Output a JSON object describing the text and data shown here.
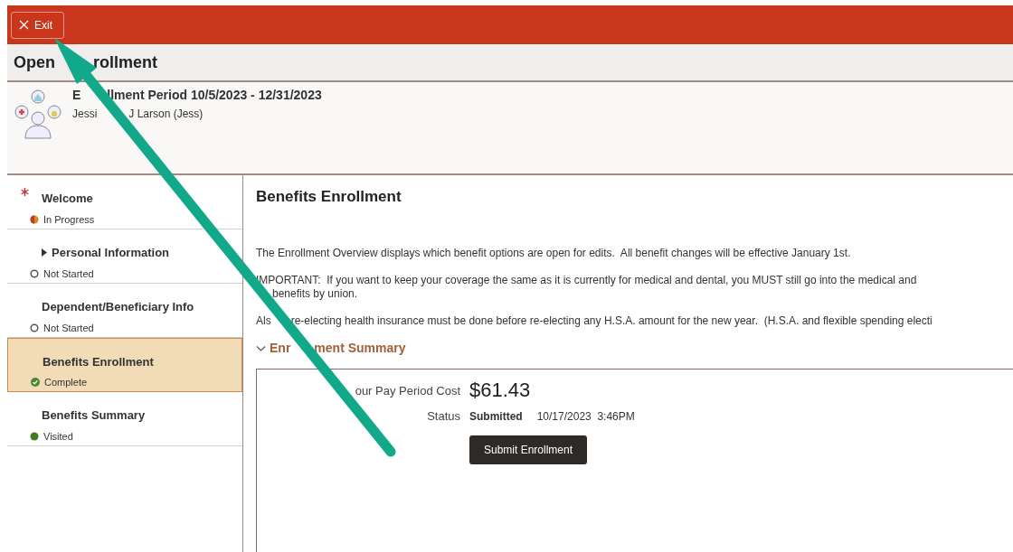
{
  "header_bar": {
    "exit_button": {
      "label": "Exit"
    }
  },
  "page_title": [
    "Open",
    "rollment"
  ],
  "enrollment_info": {
    "period": [
      "E",
      "llment Period 10/5/2023 - 12/31/2023"
    ],
    "employee": [
      "Jessi",
      "J Larson (Jess)"
    ]
  },
  "steps": [
    {
      "label": "Welcome",
      "status": "In Progress",
      "kind": "in_progress",
      "required": true,
      "expandable": false,
      "selected": false
    },
    {
      "label": "Personal Information",
      "status": "Not Started",
      "kind": "not_started",
      "required": false,
      "expandable": true,
      "selected": false
    },
    {
      "label": "Dependent/Beneficiary Info",
      "status": "Not Started",
      "kind": "not_started",
      "required": false,
      "expandable": false,
      "selected": false
    },
    {
      "label": "Benefits Enrollment",
      "status": "Complete",
      "kind": "complete",
      "required": false,
      "expandable": false,
      "selected": true
    },
    {
      "label": "Benefits Summary",
      "status": "Visited",
      "kind": "visited",
      "required": false,
      "expandable": false,
      "selected": false
    }
  ],
  "content": {
    "title": "Benefits Enrollment",
    "paragraphs": [
      [
        [
          "The Enrollment Overview displays which benefit options are open for edits.  All benefit changes will be effective January 1st."
        ]
      ],
      [
        [
          "IMPORTANT:  If you want to keep your coverage the same as it is currently for medical and dental, you MUST still go into the medical and"
        ],
        [
          "benefits by union."
        ]
      ],
      [
        [
          "Als",
          "re-electing health insurance must be done before re-electing any H.S.A. amount for the new year.  (H.S.A. and flexible spending electi"
        ]
      ]
    ],
    "summary": {
      "heading": [
        "Enr",
        "ment Summary"
      ],
      "expanded": true,
      "cost_label": "our Pay Period Cost",
      "cost": "$61.43",
      "status_label": "Status",
      "status": "Submitted",
      "date": "10/17/2023",
      "time": "3:46PM",
      "button": "Submit Enrollment"
    }
  }
}
